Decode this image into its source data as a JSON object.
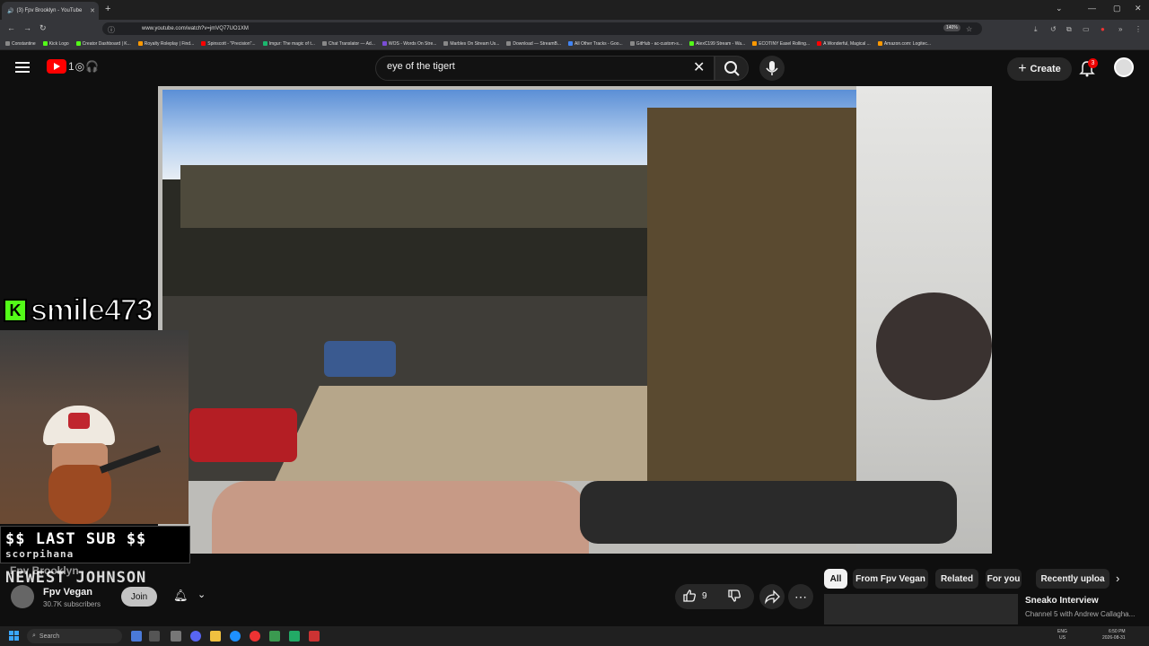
{
  "browser": {
    "tab_title": "(3) Fpv Brooklyn - YouTube",
    "url": "www.youtube.com/watch?v=jmVQ77UO1XM",
    "zoom": "140%",
    "bookmarks": [
      {
        "label": "Constantine",
        "color": "#888888"
      },
      {
        "label": "Kick Logo",
        "color": "#53fc18"
      },
      {
        "label": "Creator Dashboard | K...",
        "color": "#53fc18"
      },
      {
        "label": "Royalty Roleplay | Find...",
        "color": "#ff9900"
      },
      {
        "label": "Spinscott - \"Precision\"...",
        "color": "#ff0000"
      },
      {
        "label": "Imgur: The magic of t...",
        "color": "#1bb76e"
      },
      {
        "label": "Chat Translator — Ad...",
        "color": "#888888"
      },
      {
        "label": "WOS - Words On Stre...",
        "color": "#7a4dd6"
      },
      {
        "label": "Marbles On Stream Us...",
        "color": "#888888"
      },
      {
        "label": "Download — StreamB...",
        "color": "#888888"
      },
      {
        "label": "All Other Tracks - Goo...",
        "color": "#4285f4"
      },
      {
        "label": "GitHub - ac-custom-s...",
        "color": "#888888"
      },
      {
        "label": "AlexC199 Stream - Wa...",
        "color": "#53fc18"
      },
      {
        "label": "ECOTINY Easel Rolling...",
        "color": "#ff9900"
      },
      {
        "label": "A Wonderful, Magical ...",
        "color": "#ff0000"
      },
      {
        "label": "Amazon.com: Logitec...",
        "color": "#ff9900"
      }
    ]
  },
  "masthead": {
    "search_value": "eye of the tigert",
    "create_label": "Create",
    "notification_count": "3"
  },
  "overlay": {
    "streamer_name": "smile473",
    "kick_badge": "K",
    "last_sub_title": "$$ LAST SUB $$",
    "last_sub_name": "scorpihana",
    "newest_label": "NEWEST JOHNSON"
  },
  "video": {
    "title": "Fpv Brooklyn",
    "channel_name": "Fpv Vegan",
    "subscribers": "30.7K subscribers",
    "join_label": "Join",
    "likes": "9"
  },
  "chips": [
    {
      "label": "All",
      "active": true
    },
    {
      "label": "From Fpv Vegan",
      "active": false
    },
    {
      "label": "Related",
      "active": false
    },
    {
      "label": "For you",
      "active": false
    },
    {
      "label": "Recently uploa",
      "active": false
    }
  ],
  "recommendation": {
    "title": "Sneako Interview",
    "subtitle": "Channel 5 with Andrew Callagha..."
  },
  "taskbar": {
    "search_placeholder": "Search",
    "tray_lang": "ENG",
    "tray_region": "US",
    "time": "6:50 PM",
    "date": "2026-08-31"
  },
  "colors": {
    "youtube_red": "#ff0000",
    "kick_green": "#53fc18",
    "background": "#0f0f0f"
  }
}
